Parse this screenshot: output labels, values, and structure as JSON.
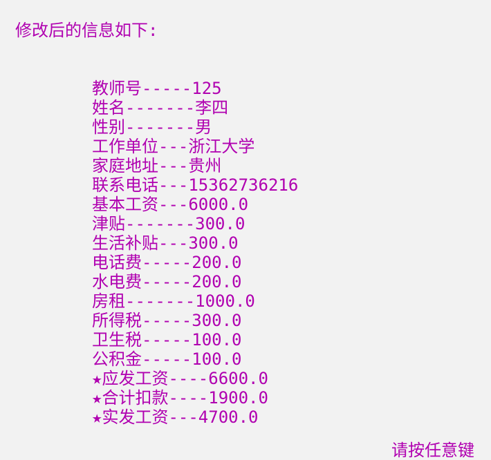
{
  "console": {
    "heading": "修改后的信息如下:",
    "lines": [
      "教师号-----125",
      "姓名-------李四",
      "性别-------男",
      "工作单位---浙江大学",
      "家庭地址---贵州",
      "联系电话---15362736216",
      "基本工资---6000.0",
      "津贴-------300.0",
      "生活补贴---300.0",
      "电话费-----200.0",
      "水电费-----200.0",
      "房租-------1000.0",
      "所得税-----300.0",
      "卫生税-----100.0",
      "公积金-----100.0",
      "★应发工资----6600.0",
      "★合计扣款----1900.0",
      "★实发工资---4700.0"
    ],
    "footer": "请按任意键"
  },
  "colors": {
    "text": "#b000b0",
    "background": "#f2f2f2"
  }
}
